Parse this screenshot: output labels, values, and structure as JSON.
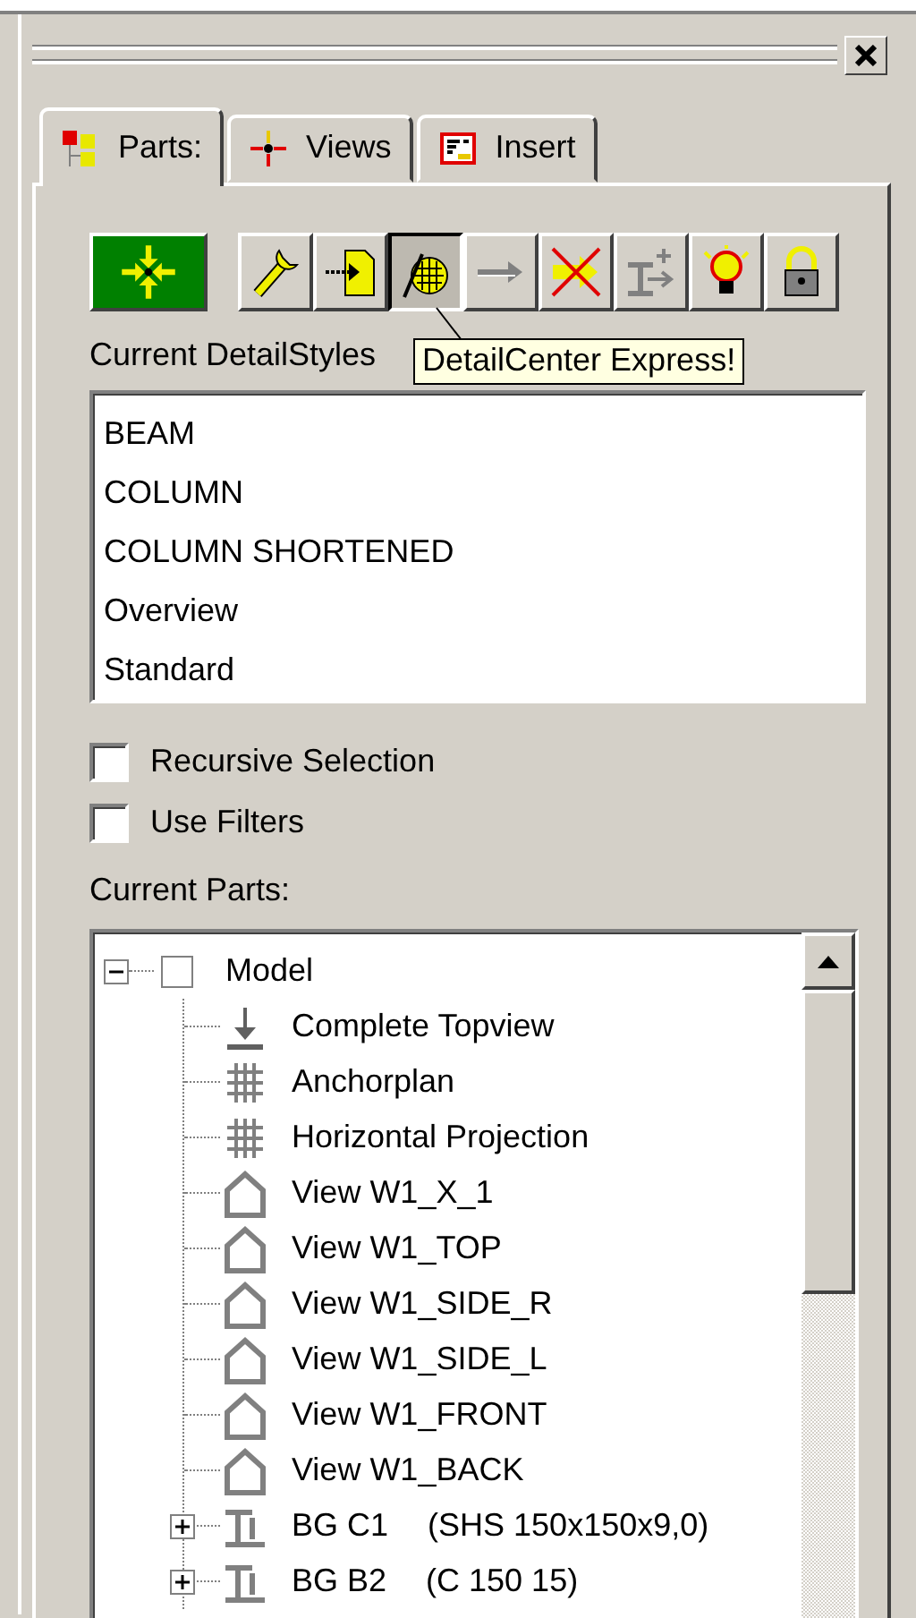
{
  "tabs": [
    {
      "label": "Parts:",
      "kind": "parts",
      "selected": true
    },
    {
      "label": "Views",
      "kind": "views",
      "selected": false
    },
    {
      "label": "Insert",
      "kind": "insert",
      "selected": false
    }
  ],
  "toolbar": {
    "main_button": {
      "kind": "converge"
    },
    "buttons": [
      {
        "kind": "wrench",
        "selected": false,
        "disabled": false
      },
      {
        "kind": "doc-arrow",
        "selected": false,
        "disabled": false
      },
      {
        "kind": "grid-pen",
        "selected": true,
        "disabled": false
      },
      {
        "kind": "arrow",
        "selected": false,
        "disabled": true
      },
      {
        "kind": "arrow-x",
        "selected": false,
        "disabled": false
      },
      {
        "kind": "beam-plus",
        "selected": false,
        "disabled": true
      },
      {
        "kind": "bulb",
        "selected": false,
        "disabled": false
      },
      {
        "kind": "lock",
        "selected": false,
        "disabled": false
      }
    ],
    "tooltip": "DetailCenter Express!"
  },
  "detail_styles": {
    "label": "Current DetailStyles",
    "items": [
      "BEAM",
      "COLUMN",
      "COLUMN SHORTENED",
      "Overview",
      "Standard"
    ]
  },
  "options": [
    {
      "label": "Recursive Selection",
      "checked": false
    },
    {
      "label": "Use Filters",
      "checked": false
    }
  ],
  "parts": {
    "label": "Current Parts:",
    "tree": [
      {
        "label": "Model",
        "kind": "root",
        "checked": false,
        "expanded": true,
        "children": [
          {
            "label": "Complete Topview",
            "kind": "topview"
          },
          {
            "label": "Anchorplan",
            "kind": "grid"
          },
          {
            "label": "Horizontal Projection",
            "kind": "grid"
          },
          {
            "label": "View W1_X_1",
            "kind": "view"
          },
          {
            "label": "View W1_TOP",
            "kind": "view"
          },
          {
            "label": "View W1_SIDE_R",
            "kind": "view"
          },
          {
            "label": "View W1_SIDE_L",
            "kind": "view"
          },
          {
            "label": "View W1_FRONT",
            "kind": "view"
          },
          {
            "label": "View W1_BACK",
            "kind": "view"
          },
          {
            "label": "BG C1",
            "profile": "(SHS 150x150x9,0)",
            "kind": "beam",
            "expanded": false
          },
          {
            "label": "BG B2",
            "profile": "(C 150 15)",
            "kind": "beam",
            "expanded": false
          }
        ]
      }
    ]
  }
}
